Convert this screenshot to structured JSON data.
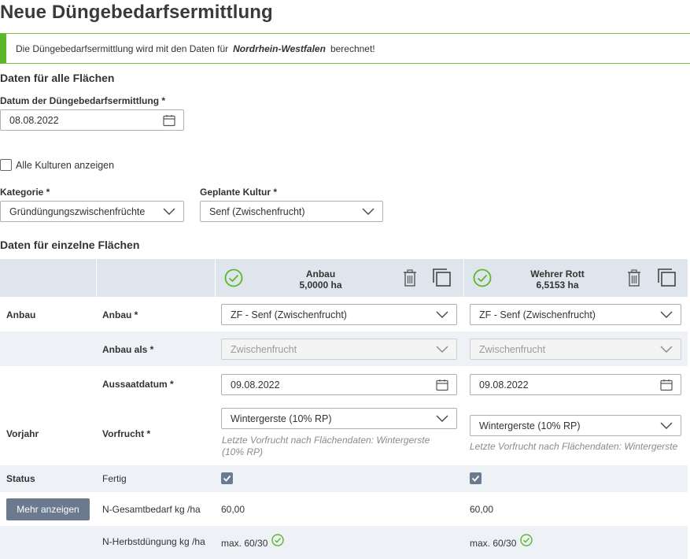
{
  "page": {
    "title": "Neue Düngebedarfsermittlung"
  },
  "banner": {
    "prefix": "Die Düngebedarfsermittlung wird mit den Daten für",
    "region": "Nordrhein-Westfalen",
    "suffix": "berechnet!"
  },
  "general": {
    "section_title": "Daten für alle Flächen",
    "date_label": "Datum der Düngebedarfsermittlung *",
    "date_value": "08.08.2022",
    "show_all_label": "Alle Kulturen anzeigen",
    "category_label": "Kategorie *",
    "category_value": "Gründüngungszwischenfrüchte",
    "crop_label": "Geplante Kultur *",
    "crop_value": "Senf (Zwischenfrucht)"
  },
  "fields": {
    "section_title": "Daten für einzelne Flächen",
    "columns": [
      {
        "name": "Anbau",
        "area": "5,0000 ha"
      },
      {
        "name": "Wehrer Rott",
        "area": "6,5153 ha"
      }
    ],
    "groups": {
      "anbau": "Anbau",
      "vorjahr": "Vorjahr",
      "status": "Status"
    },
    "labels": {
      "anbau": "Anbau *",
      "anbau_als": "Anbau als *",
      "aussaat": "Aussaatdatum *",
      "vorfrucht": "Vorfrucht *",
      "status": "Fertig",
      "n_gesamt": "N-Gesamtbedarf kg /ha",
      "n_herbst": "N-Herbstdüngung kg /ha"
    },
    "col1": {
      "anbau": "ZF - Senf (Zwischenfrucht)",
      "anbau_als": "Zwischenfrucht",
      "aussaat": "09.08.2022",
      "vorfrucht": "Wintergerste (10% RP)",
      "vorfrucht_hint": "Letzte Vorfrucht nach Flächendaten: Wintergerste (10% RP)",
      "n_gesamt": "60,00",
      "n_herbst": "max. 60/30"
    },
    "col2": {
      "anbau": "ZF - Senf (Zwischenfrucht)",
      "anbau_als": "Zwischenfrucht",
      "aussaat": "09.08.2022",
      "vorfrucht": "Wintergerste (10% RP)",
      "vorfrucht_hint": "Letzte Vorfrucht nach Flächendaten: Wintergerste",
      "n_gesamt": "60,00",
      "n_herbst": "max. 60/30"
    },
    "more_button": "Mehr anzeigen"
  },
  "colors": {
    "accent_green": "#5cb82a",
    "header_band": "#dfe5ed",
    "stripe": "#eef2f7",
    "button": "#6b7a8f"
  }
}
